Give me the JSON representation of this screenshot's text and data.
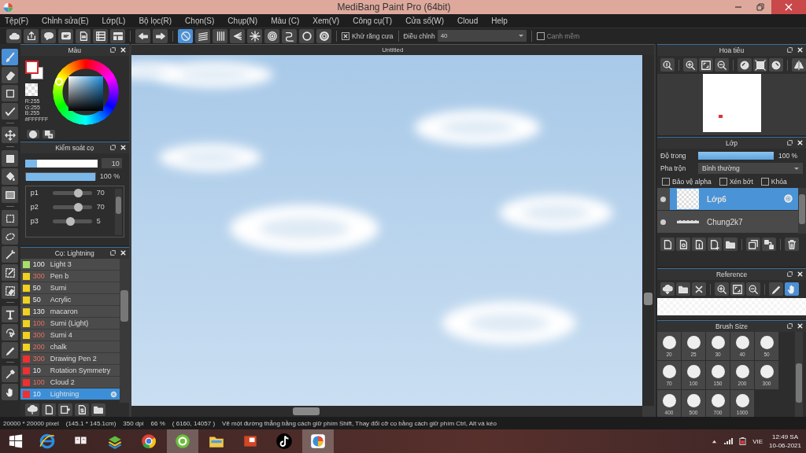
{
  "window": {
    "title": "MediBang Paint Pro (64bit)"
  },
  "menu": [
    "Tệp(F)",
    "Chỉnh sửa(E)",
    "Lớp(L)",
    "Bộ lọc(R)",
    "Chọn(S)",
    "Chụp(N)",
    "Màu (C)",
    "Xem(V)",
    "Công cụ(T)",
    "Cửa sổ(W)",
    "Cloud",
    "Help"
  ],
  "toolbar": {
    "snap_modes": [
      {
        "kind": "off",
        "selected": true
      },
      {
        "kind": "parallel",
        "selected": false
      },
      {
        "kind": "grid",
        "selected": false
      },
      {
        "kind": "perspective",
        "selected": false
      },
      {
        "kind": "radial",
        "selected": false
      },
      {
        "kind": "concentric",
        "selected": false
      },
      {
        "kind": "curve",
        "selected": false
      },
      {
        "kind": "circle",
        "selected": false
      }
    ],
    "antialias": {
      "label": "Khử răng cưa",
      "checked": true
    },
    "correction": {
      "label": "Điều chỉnh",
      "value": "40"
    },
    "soft_edge": {
      "label": "Canh mềm",
      "checked": false
    }
  },
  "tools": [
    {
      "kind": "brush",
      "selected": true
    },
    {
      "kind": "eraser",
      "selected": false
    },
    {
      "kind": "dot",
      "selected": false
    },
    {
      "kind": "stroke",
      "selected": false
    },
    {
      "kind": "move",
      "selected": false
    },
    {
      "kind": "fill-rect",
      "selected": false
    },
    {
      "kind": "bucket",
      "selected": false
    },
    {
      "kind": "gradient",
      "selected": false
    },
    {
      "kind": "select-rect",
      "selected": false
    },
    {
      "kind": "lasso",
      "selected": false
    },
    {
      "kind": "wand",
      "selected": false
    },
    {
      "kind": "select-pen",
      "selected": false
    },
    {
      "kind": "select-eraser",
      "selected": false
    },
    {
      "kind": "text",
      "selected": false
    },
    {
      "kind": "operation",
      "selected": false
    },
    {
      "kind": "pen",
      "selected": false
    },
    {
      "kind": "dropper",
      "selected": false
    },
    {
      "kind": "hand",
      "selected": false
    }
  ],
  "color_panel": {
    "title": "Màu",
    "readouts": [
      "R:255",
      "G:255",
      "B:255",
      "#FFFFFF"
    ]
  },
  "brush_control": {
    "title": "Kiểm soát cọ",
    "size": {
      "level": 0.17,
      "reading": "10"
    },
    "opacity": {
      "level": 1,
      "reading": "100 %"
    },
    "params": [
      {
        "label": "p1",
        "level": 0.65,
        "reading": "70"
      },
      {
        "label": "p2",
        "level": 0.65,
        "reading": "70"
      },
      {
        "label": "p3",
        "level": 0.45,
        "reading": "5"
      }
    ]
  },
  "brush_list": {
    "title": "Cọ: Lightning",
    "brushes": [
      {
        "size": "100",
        "name": "Light 3",
        "color": "#a8dd6a",
        "flagged": false,
        "selected": false
      },
      {
        "size": "300",
        "name": "Pen b",
        "color": "#f0d020",
        "flagged": true,
        "selected": false
      },
      {
        "size": "50",
        "name": "Sumi",
        "color": "#f0d020",
        "flagged": false,
        "selected": false
      },
      {
        "size": "50",
        "name": "Acrylic",
        "color": "#f0d020",
        "flagged": false,
        "selected": false
      },
      {
        "size": "130",
        "name": "macaron",
        "color": "#f0d020",
        "flagged": false,
        "selected": false
      },
      {
        "size": "100",
        "name": "Sumi (Light)",
        "color": "#f0d020",
        "flagged": true,
        "selected": false
      },
      {
        "size": "300",
        "name": "Sumi 4",
        "color": "#f0d020",
        "flagged": true,
        "selected": false
      },
      {
        "size": "200",
        "name": "chalk",
        "color": "#f0d020",
        "flagged": true,
        "selected": false
      },
      {
        "size": "300",
        "name": "Drawing Pen 2",
        "color": "#ee3030",
        "flagged": true,
        "selected": false
      },
      {
        "size": "10",
        "name": "Rotation Symmetry",
        "color": "#ee3030",
        "flagged": false,
        "selected": false
      },
      {
        "size": "100",
        "name": "Cloud 2",
        "color": "#ee3030",
        "flagged": true,
        "selected": false
      },
      {
        "size": "10",
        "name": "Lightning",
        "color": "#ee3030",
        "flagged": false,
        "selected": true
      }
    ]
  },
  "canvas": {
    "tab": "Untitled"
  },
  "navigator": {
    "title": "Hoa tiêu"
  },
  "layer_panel": {
    "title": "Lớp",
    "opacity": {
      "label": "Độ trong",
      "level": 1,
      "reading": "100 %"
    },
    "blend": {
      "label": "Pha trộn",
      "value": "Bình thường"
    },
    "options": [
      {
        "label": "Bảo vệ alpha",
        "checked": false
      },
      {
        "label": "Xén bớt",
        "checked": false
      },
      {
        "label": "Khóa",
        "checked": false
      }
    ],
    "layers": [
      {
        "name": "Lớp6",
        "selected": true
      },
      {
        "name": "Chung2k7",
        "selected": false
      }
    ]
  },
  "reference": {
    "title": "Reference",
    "tools": [
      {
        "kind": "cloud-open",
        "selected": false
      },
      {
        "kind": "folder",
        "selected": false
      },
      {
        "kind": "close",
        "selected": false
      },
      {
        "kind": "zoom-in",
        "selected": false
      },
      {
        "kind": "fit",
        "selected": false
      },
      {
        "kind": "zoom-out",
        "selected": false
      },
      {
        "kind": "pen",
        "selected": false
      },
      {
        "kind": "hand",
        "selected": true
      }
    ]
  },
  "brush_size": {
    "title": "Brush Size",
    "sizes": [
      "20",
      "25",
      "30",
      "40",
      "50",
      "70",
      "100",
      "150",
      "200",
      "300",
      "400",
      "500",
      "700",
      "1000"
    ]
  },
  "status_bar": {
    "items": [
      "20000 * 20000 pixel",
      "(145.1 * 145.1cm)",
      "350 dpi",
      "66 %",
      "( 6160, 14057 )",
      "Vẽ một đường thẳng bằng cách giữ phím Shift, Thay đổi cỡ cọ bằng cách giữ phím Ctrl, Alt và kéo"
    ]
  },
  "taskbar": {
    "apps": [
      {
        "kind": "ie",
        "selected": false
      },
      {
        "kind": "mahjong",
        "selected": false
      },
      {
        "kind": "bluestacks",
        "selected": false
      },
      {
        "kind": "chrome",
        "selected": false
      },
      {
        "kind": "coccoc",
        "selected": true
      },
      {
        "kind": "explorer",
        "selected": false
      },
      {
        "kind": "powerpoint",
        "selected": false
      },
      {
        "kind": "tiktok",
        "selected": false
      },
      {
        "kind": "medibang",
        "selected": true
      }
    ],
    "language": "VIE",
    "time": "12:49 SA",
    "date": "10-06-2021"
  }
}
